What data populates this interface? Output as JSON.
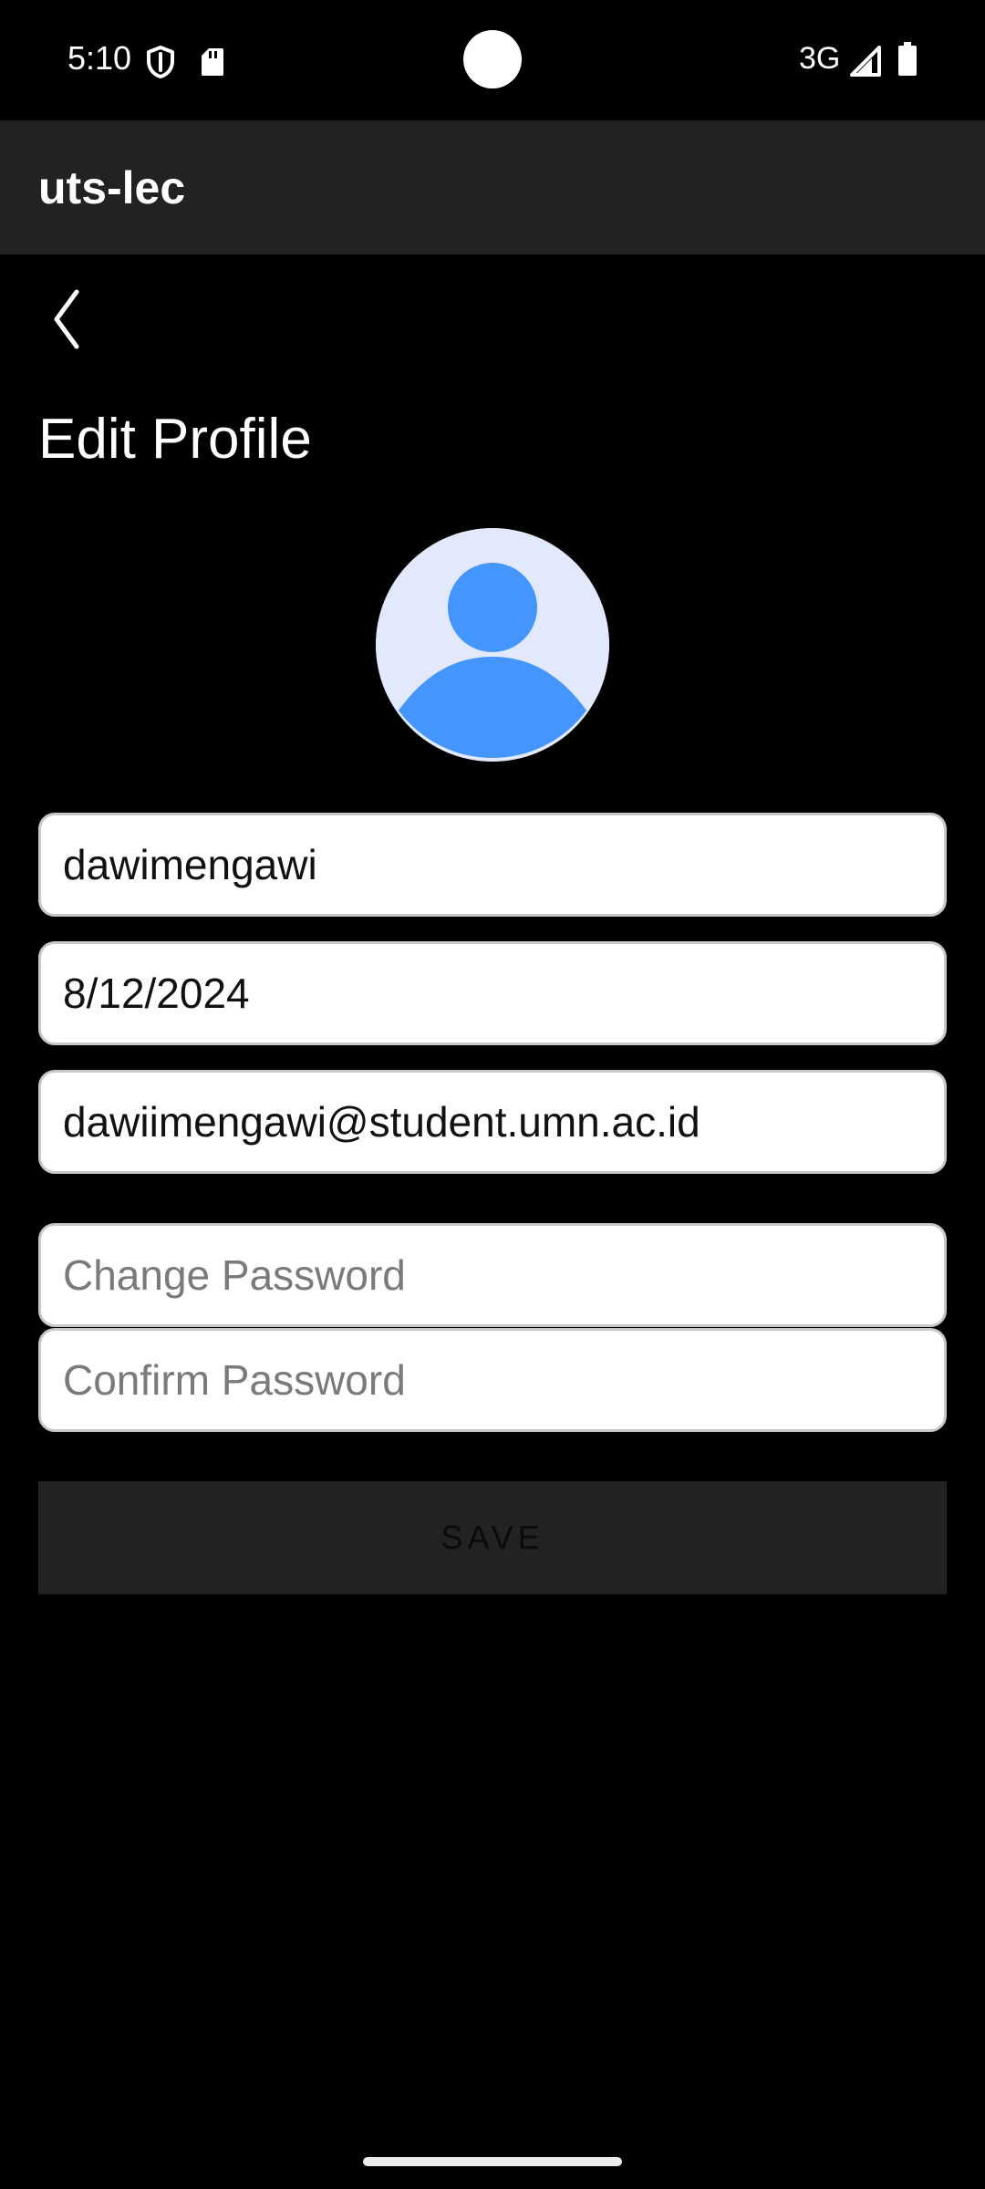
{
  "status_bar": {
    "time": "5:10",
    "network": "3G",
    "icons": [
      "shield-icon",
      "sd-card-icon",
      "signal-icon",
      "battery-icon"
    ]
  },
  "app_bar": {
    "title": "uts-lec"
  },
  "page": {
    "back_icon": "chevron-left-icon",
    "title": "Edit Profile"
  },
  "avatar": {
    "icon": "person-icon",
    "colors": {
      "background": "#e2e9fc",
      "figure": "#4495fe"
    }
  },
  "form": {
    "username": {
      "value": "dawimengawi",
      "placeholder": ""
    },
    "birthdate": {
      "value": "8/12/2024",
      "placeholder": ""
    },
    "email": {
      "value": "dawiimengawi@student.umn.ac.id",
      "placeholder": ""
    },
    "change_password": {
      "value": "",
      "placeholder": "Change Password"
    },
    "confirm_password": {
      "value": "",
      "placeholder": "Confirm Password"
    },
    "save_label": "SAVE"
  },
  "theme": {
    "background": "#000000",
    "app_bar": "#222222",
    "field_background": "#ffffff",
    "field_border": "#c8c8c8",
    "save_button": "#222222"
  }
}
